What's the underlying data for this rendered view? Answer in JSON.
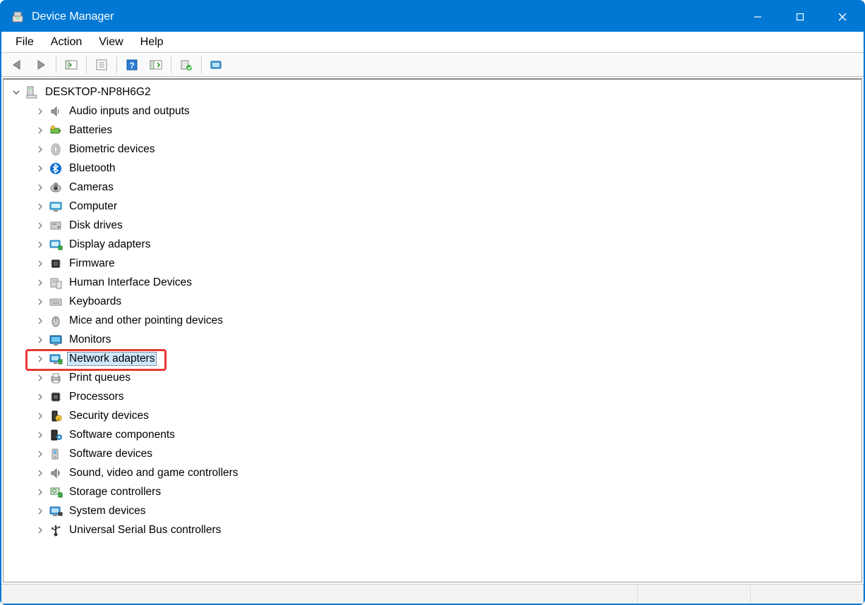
{
  "window": {
    "title": "Device Manager"
  },
  "menubar": {
    "items": [
      "File",
      "Action",
      "View",
      "Help"
    ]
  },
  "toolbar": {
    "buttons": [
      "back",
      "forward",
      "sep",
      "show-hide-tree",
      "sep",
      "properties",
      "sep",
      "help",
      "update-driver",
      "sep",
      "uninstall",
      "sep",
      "scan-hardware"
    ]
  },
  "tree": {
    "root": {
      "label": "DESKTOP-NP8H6G2",
      "icon": "computer-tower-icon",
      "expanded": true
    },
    "children": [
      {
        "label": "Audio inputs and outputs",
        "icon": "speaker-icon"
      },
      {
        "label": "Batteries",
        "icon": "battery-icon"
      },
      {
        "label": "Biometric devices",
        "icon": "fingerprint-icon"
      },
      {
        "label": "Bluetooth",
        "icon": "bluetooth-icon"
      },
      {
        "label": "Cameras",
        "icon": "camera-icon"
      },
      {
        "label": "Computer",
        "icon": "monitor-icon"
      },
      {
        "label": "Disk drives",
        "icon": "disk-icon"
      },
      {
        "label": "Display adapters",
        "icon": "display-adapter-icon"
      },
      {
        "label": "Firmware",
        "icon": "chip-icon"
      },
      {
        "label": "Human Interface Devices",
        "icon": "hid-icon"
      },
      {
        "label": "Keyboards",
        "icon": "keyboard-icon"
      },
      {
        "label": "Mice and other pointing devices",
        "icon": "mouse-icon"
      },
      {
        "label": "Monitors",
        "icon": "monitor-blue-icon"
      },
      {
        "label": "Network adapters",
        "icon": "network-adapter-icon",
        "selected": true,
        "highlighted": true
      },
      {
        "label": "Print queues",
        "icon": "printer-icon"
      },
      {
        "label": "Processors",
        "icon": "processor-icon"
      },
      {
        "label": "Security devices",
        "icon": "security-icon"
      },
      {
        "label": "Software components",
        "icon": "software-component-icon"
      },
      {
        "label": "Software devices",
        "icon": "software-device-icon"
      },
      {
        "label": "Sound, video and game controllers",
        "icon": "sound-icon"
      },
      {
        "label": "Storage controllers",
        "icon": "storage-icon"
      },
      {
        "label": "System devices",
        "icon": "system-device-icon"
      },
      {
        "label": "Universal Serial Bus controllers",
        "icon": "usb-icon"
      }
    ]
  }
}
